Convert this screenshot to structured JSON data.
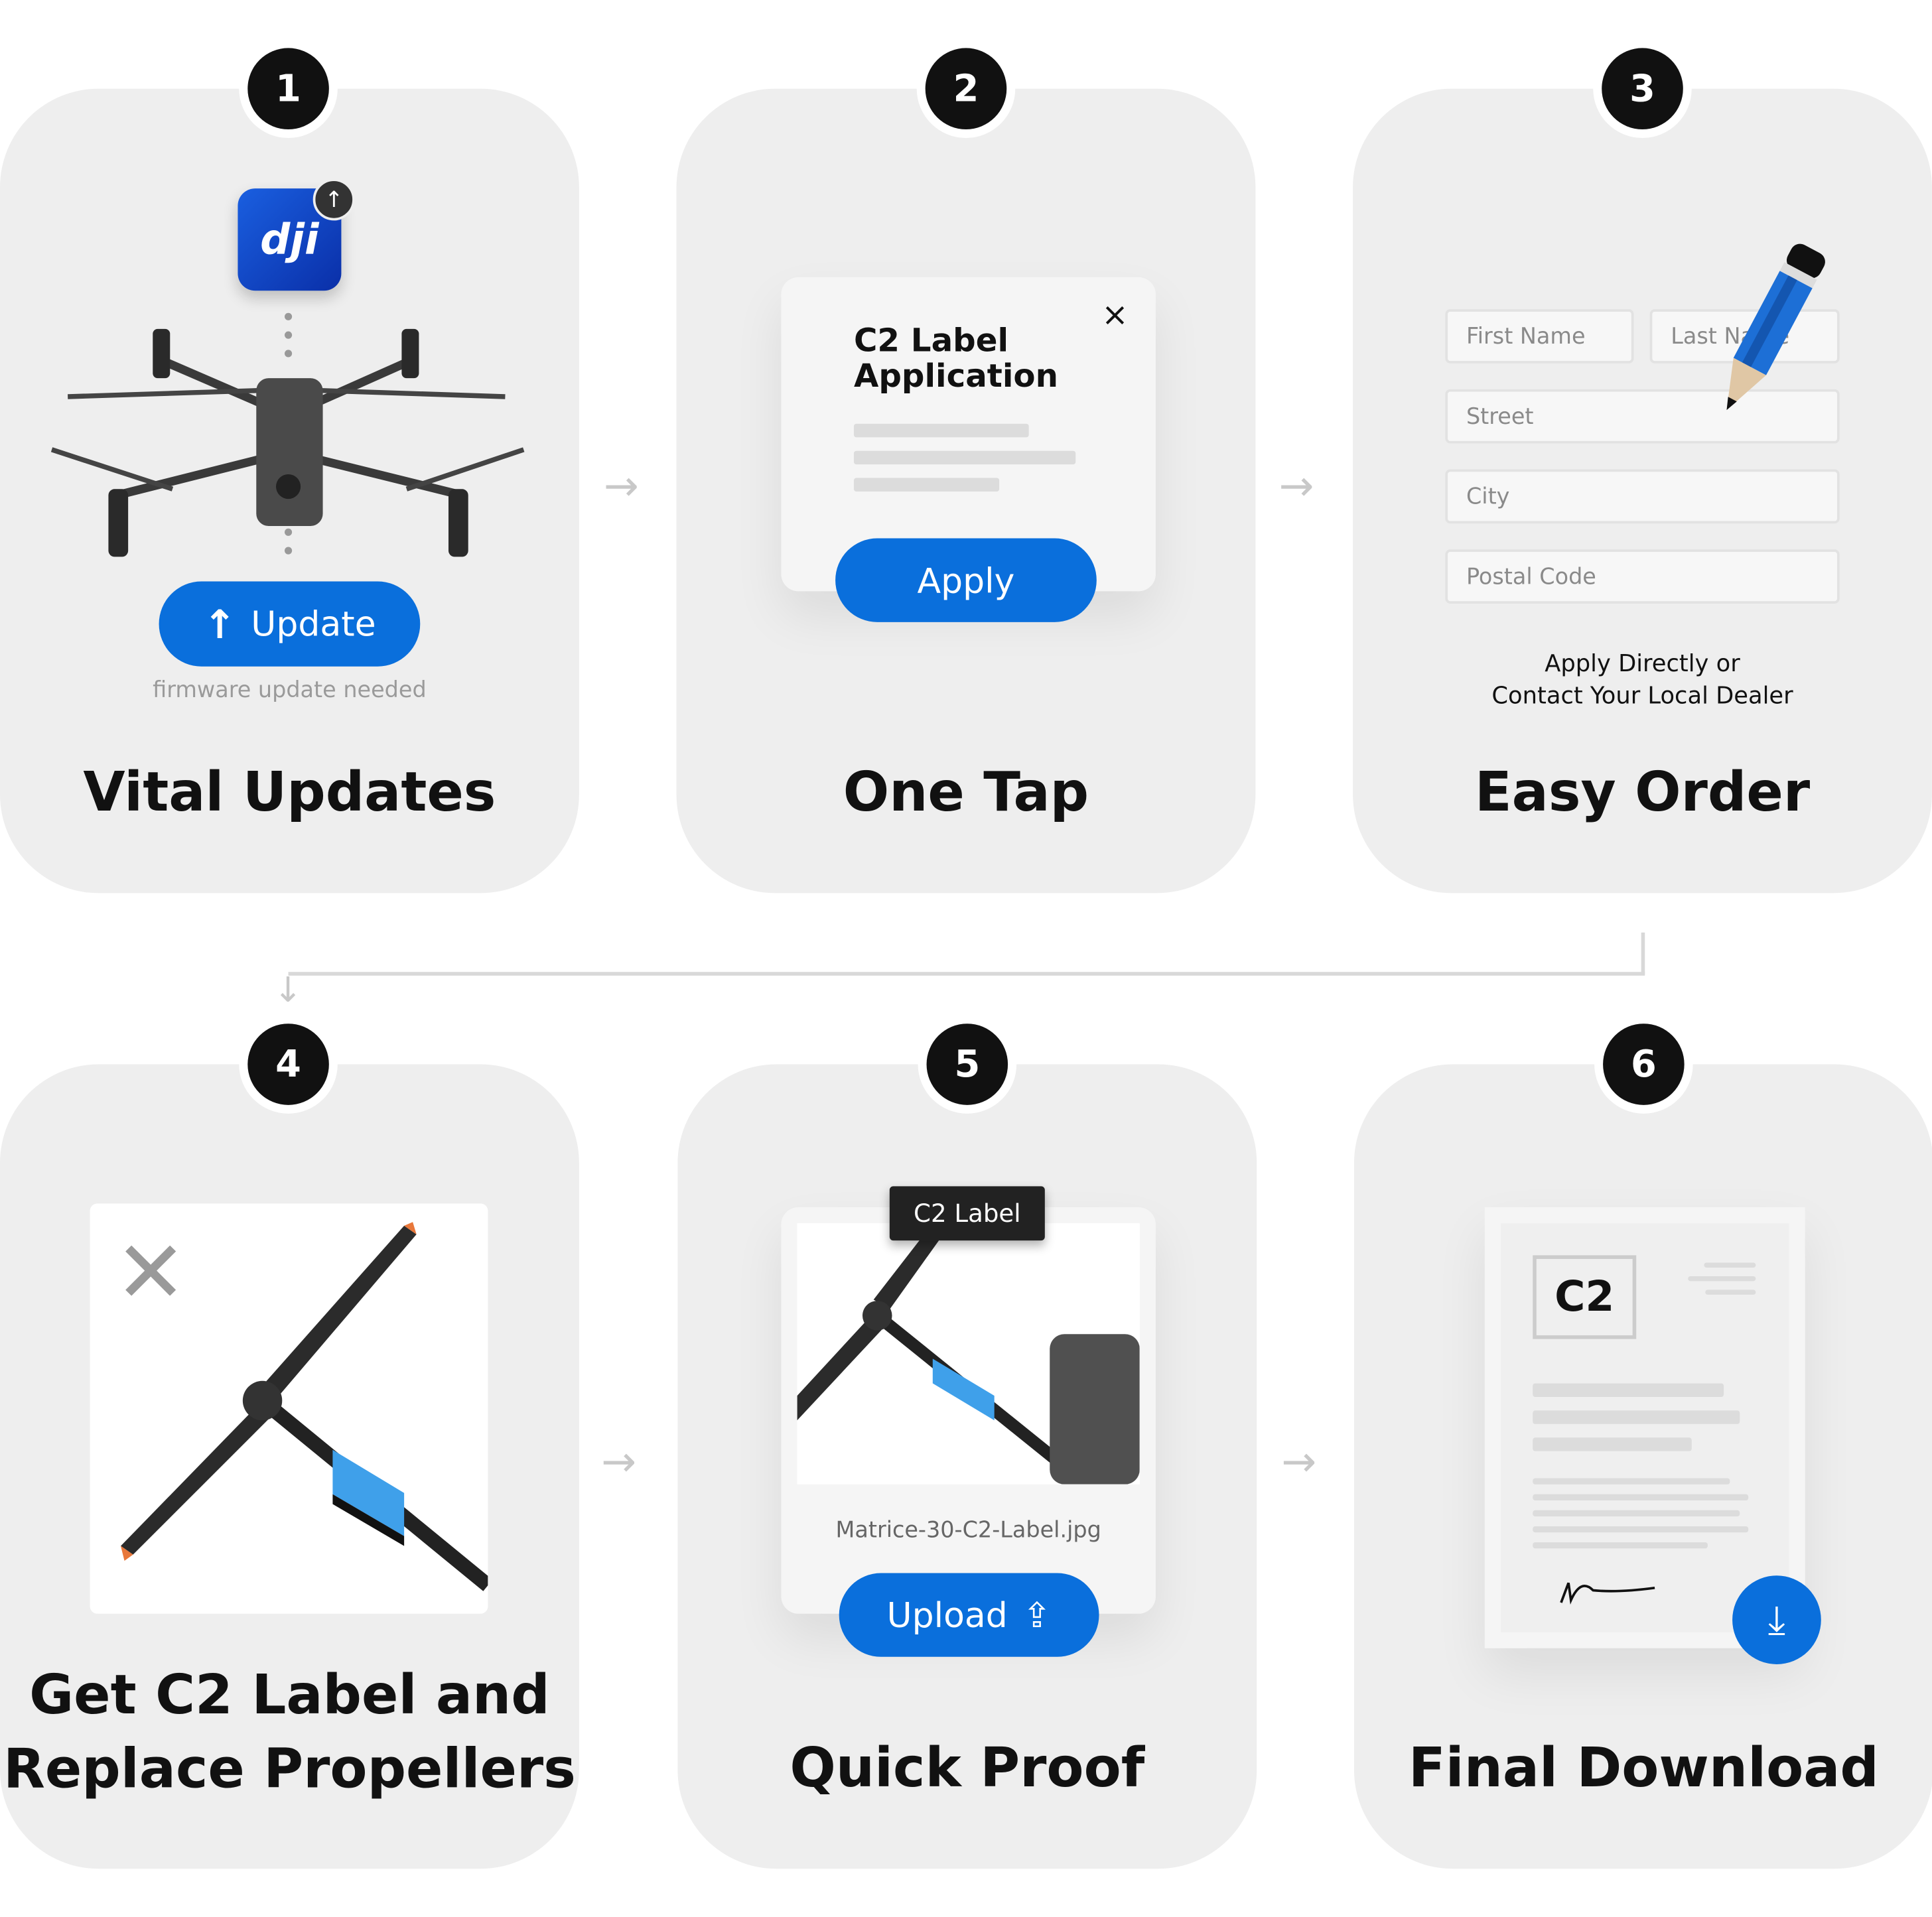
{
  "steps": [
    {
      "number": "1",
      "title": "Vital Updates",
      "button": "Update",
      "note": "firmware update needed",
      "app_logo": "dji"
    },
    {
      "number": "2",
      "title": "One Tap",
      "dialog_title_line1": "C2 Label",
      "dialog_title_line2": "Application",
      "close": "×",
      "button": "Apply"
    },
    {
      "number": "3",
      "title": "Easy Order",
      "fields": [
        "First Name",
        "Last Name",
        "Street",
        "City",
        "Postal Code"
      ],
      "note_line1": "Apply Directly or",
      "note_line2": "Contact Your Local Dealer"
    },
    {
      "number": "4",
      "title_line1": "Get C2 Label and",
      "title_line2": "Replace Propellers"
    },
    {
      "number": "5",
      "title": "Quick Proof",
      "tag": "C2 Label",
      "filename": "Matrice-30-C2-Label.jpg",
      "button": "Upload"
    },
    {
      "number": "6",
      "title": "Final Download",
      "doc_label": "C2"
    }
  ],
  "colors": {
    "accent": "#0a6fdc",
    "card": "#eeeeee",
    "badge": "#111111"
  }
}
